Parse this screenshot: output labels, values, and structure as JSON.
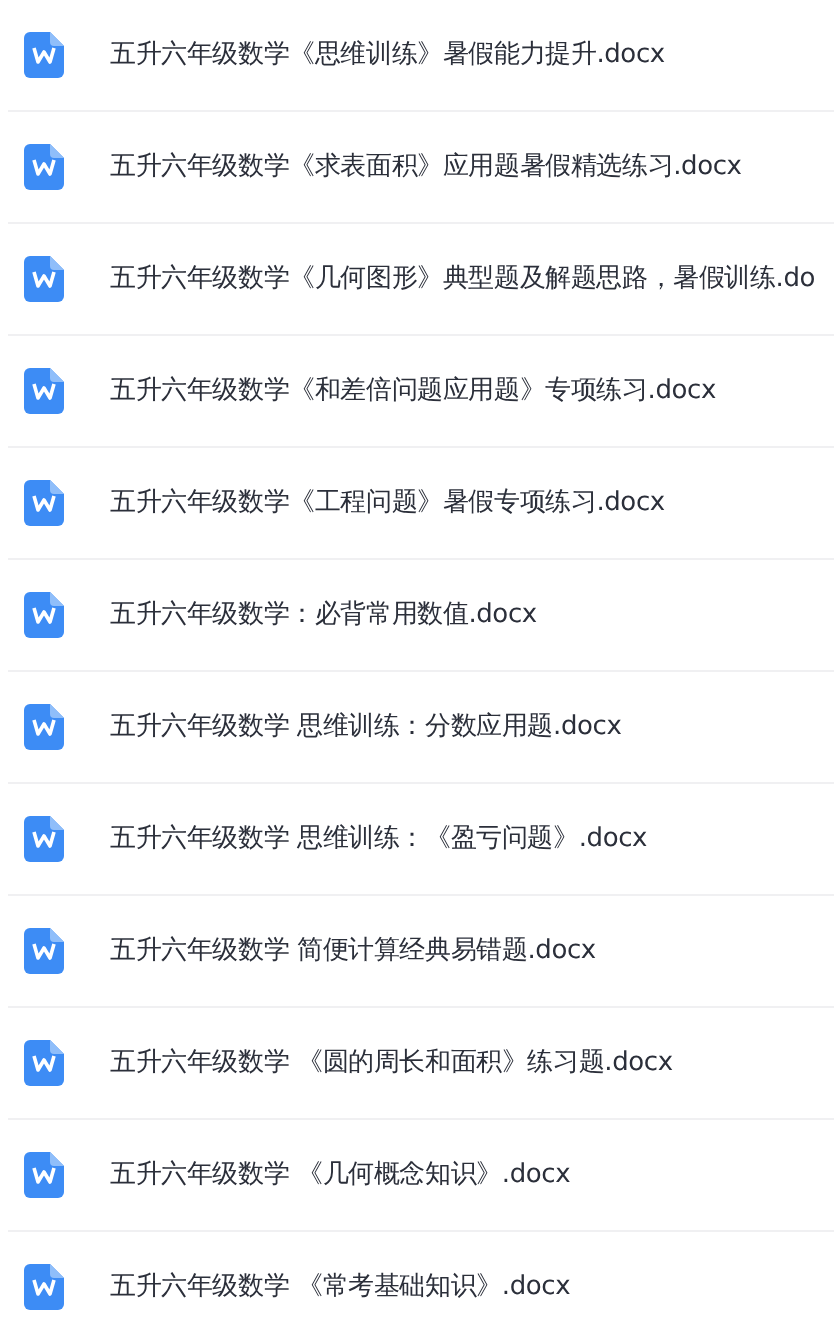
{
  "files": [
    {
      "name": "五升六年级数学《思维训练》暑假能力提升.docx"
    },
    {
      "name": "五升六年级数学《求表面积》应用题暑假精选练习.docx"
    },
    {
      "name": "五升六年级数学《几何图形》典型题及解题思路，暑假训练.do"
    },
    {
      "name": "五升六年级数学《和差倍问题应用题》专项练习.docx"
    },
    {
      "name": "五升六年级数学《工程问题》暑假专项练习.docx"
    },
    {
      "name": "五升六年级数学：必背常用数值.docx"
    },
    {
      "name": "五升六年级数学 思维训练：分数应用题.docx"
    },
    {
      "name": "五升六年级数学 思维训练：《盈亏问题》.docx"
    },
    {
      "name": "五升六年级数学 简便计算经典易错题.docx"
    },
    {
      "name": "五升六年级数学 《圆的周长和面积》练习题.docx"
    },
    {
      "name": "五升六年级数学 《几何概念知识》.docx"
    },
    {
      "name": "五升六年级数学 《常考基础知识》.docx"
    }
  ]
}
